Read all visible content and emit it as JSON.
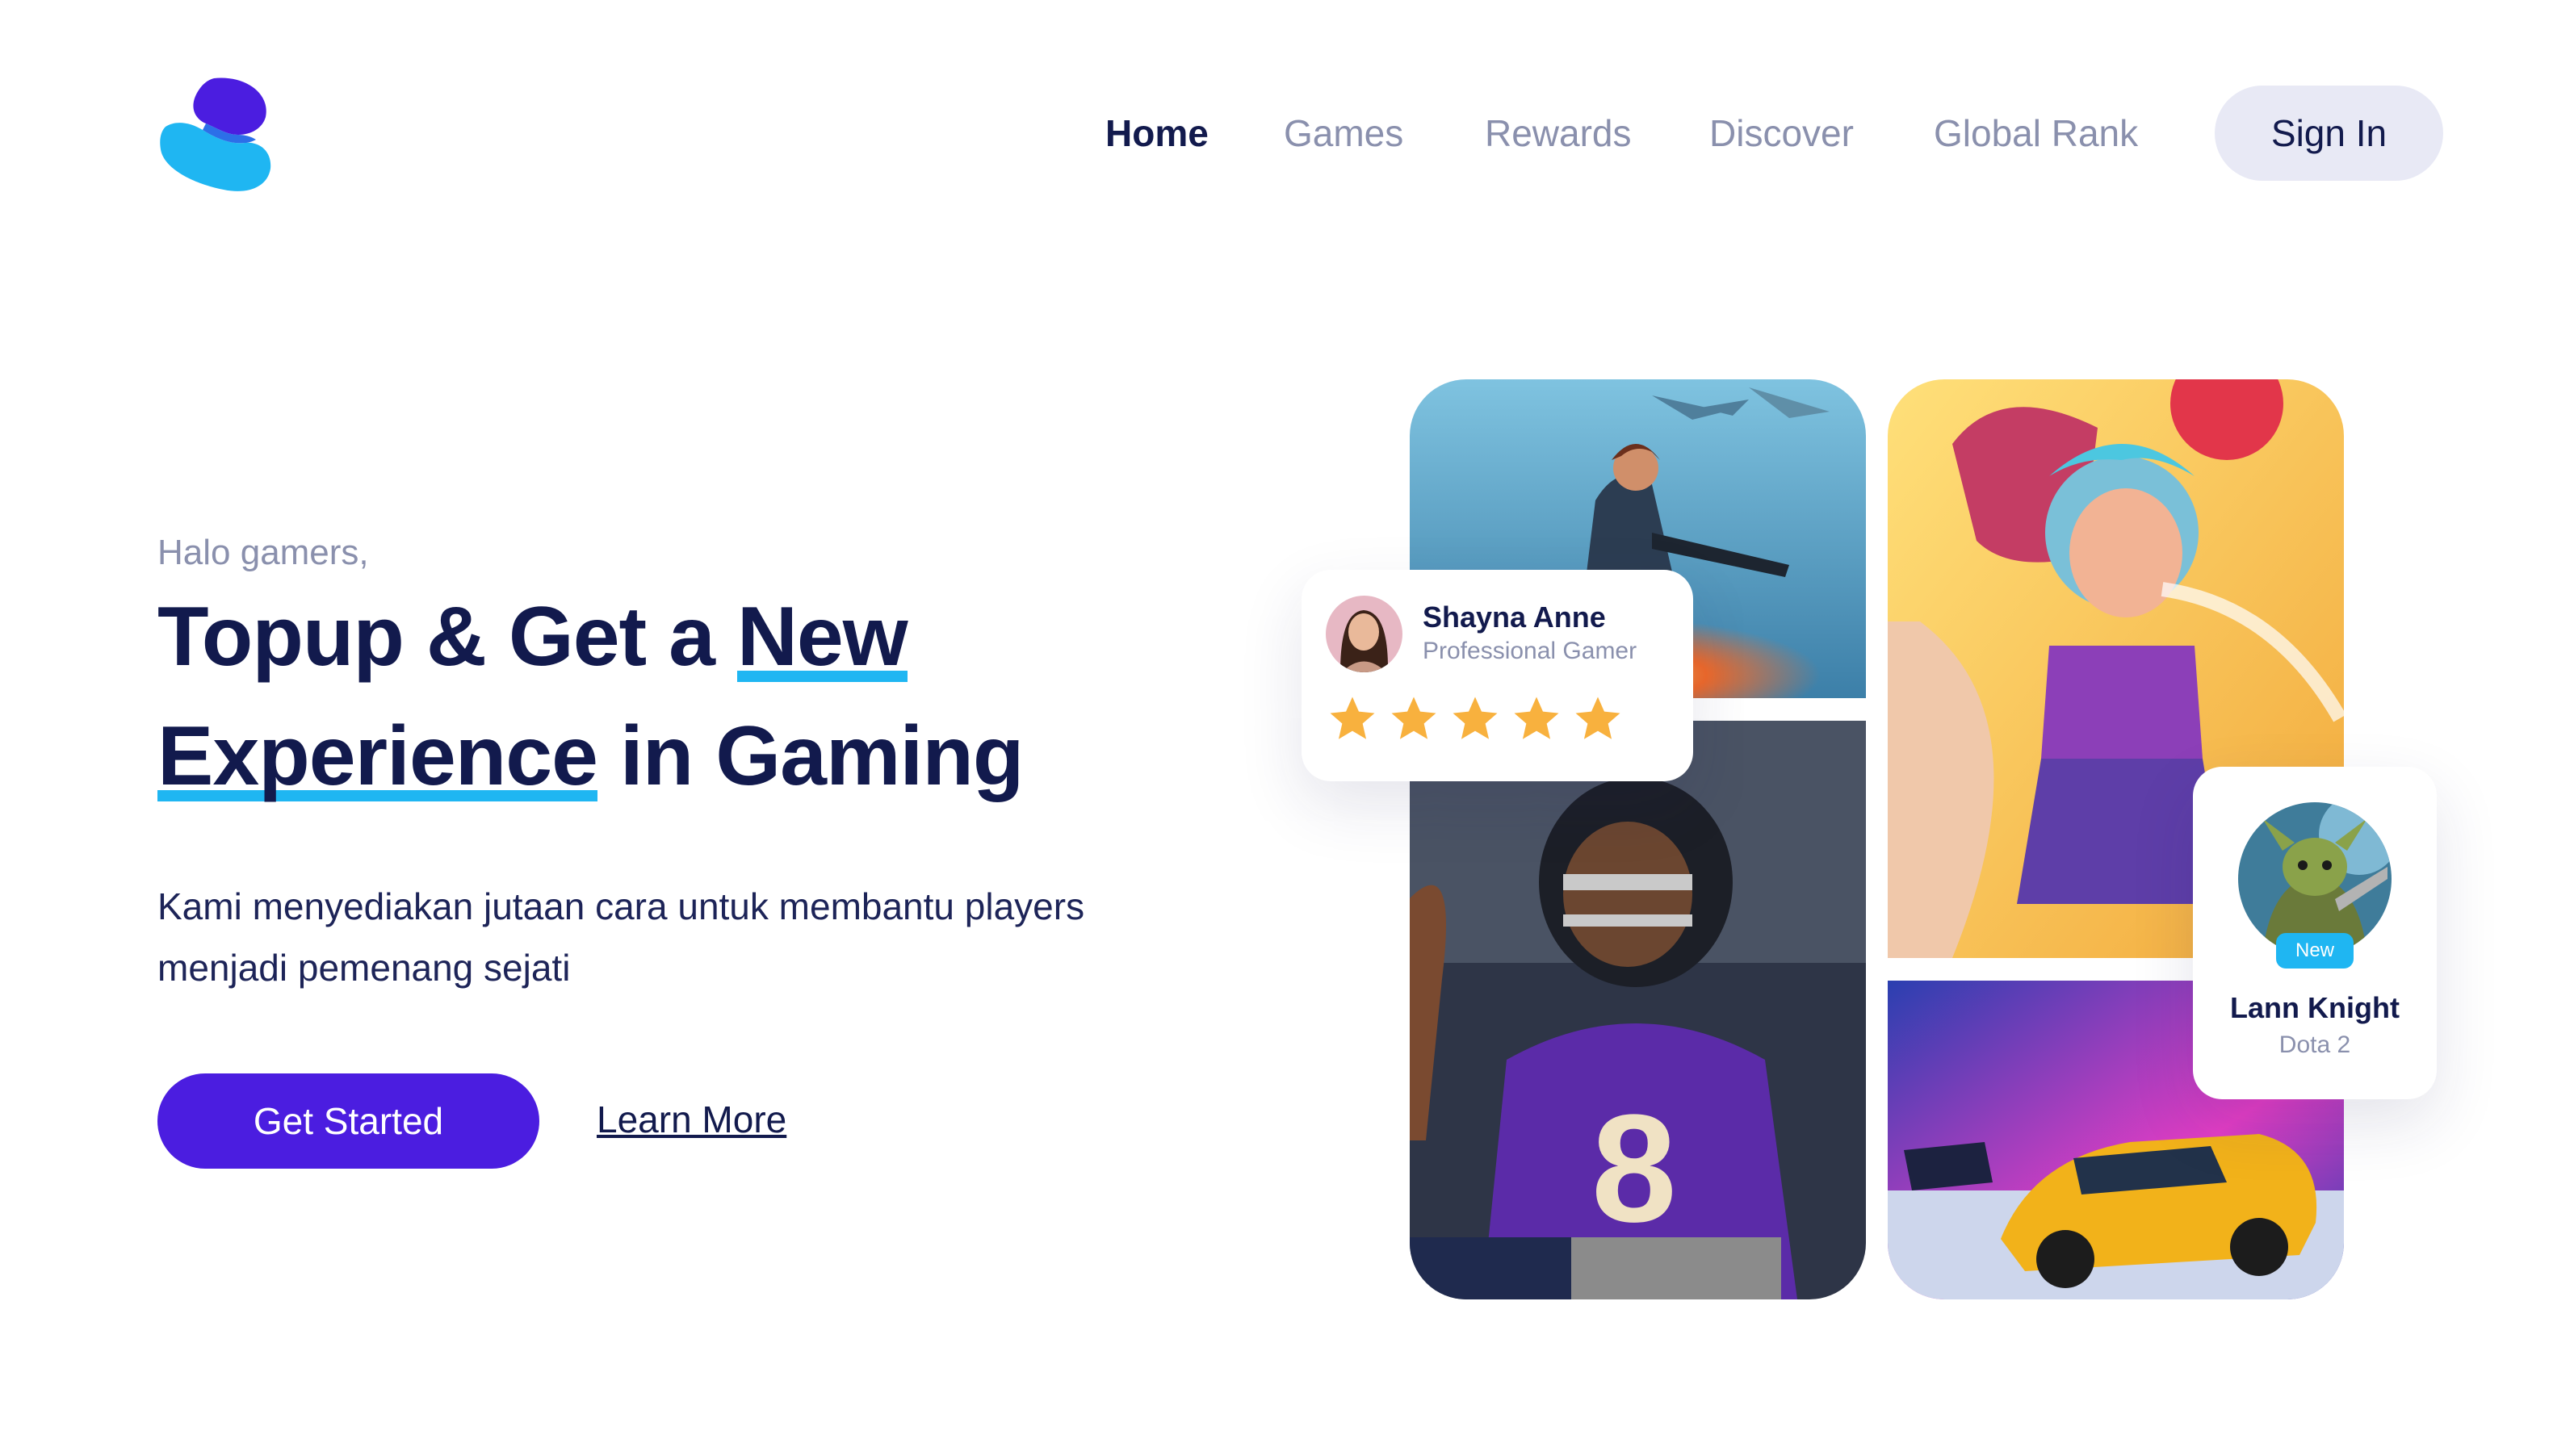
{
  "header": {
    "logo_icon": "brand-s-logo",
    "nav": [
      "Home",
      "Games",
      "Rewards",
      "Discover",
      "Global Rank"
    ],
    "active_nav": "Home",
    "sign_in": "Sign In"
  },
  "hero": {
    "greeting": "Halo gamers,",
    "headline_part1": "Topup & Get a ",
    "headline_highlight1": "New",
    "headline_highlight2": "Experience",
    "headline_part2": " in Gaming",
    "description": "Kami menyediakan jutaan cara untuk membantu players menjadi pemenang sejati",
    "cta_primary": "Get Started",
    "cta_secondary": "Learn More"
  },
  "profile_card": {
    "name": "Shayna Anne",
    "role": "Professional Gamer",
    "rating": 5,
    "star_icon": "star-icon"
  },
  "player_card": {
    "badge": "New",
    "name": "Lann Knight",
    "game": "Dota 2"
  },
  "colors": {
    "primary": "#4b1de0",
    "accent": "#1fb6f2",
    "heading": "#121a4d",
    "muted": "#8a90ad",
    "star": "#f8b13e"
  }
}
